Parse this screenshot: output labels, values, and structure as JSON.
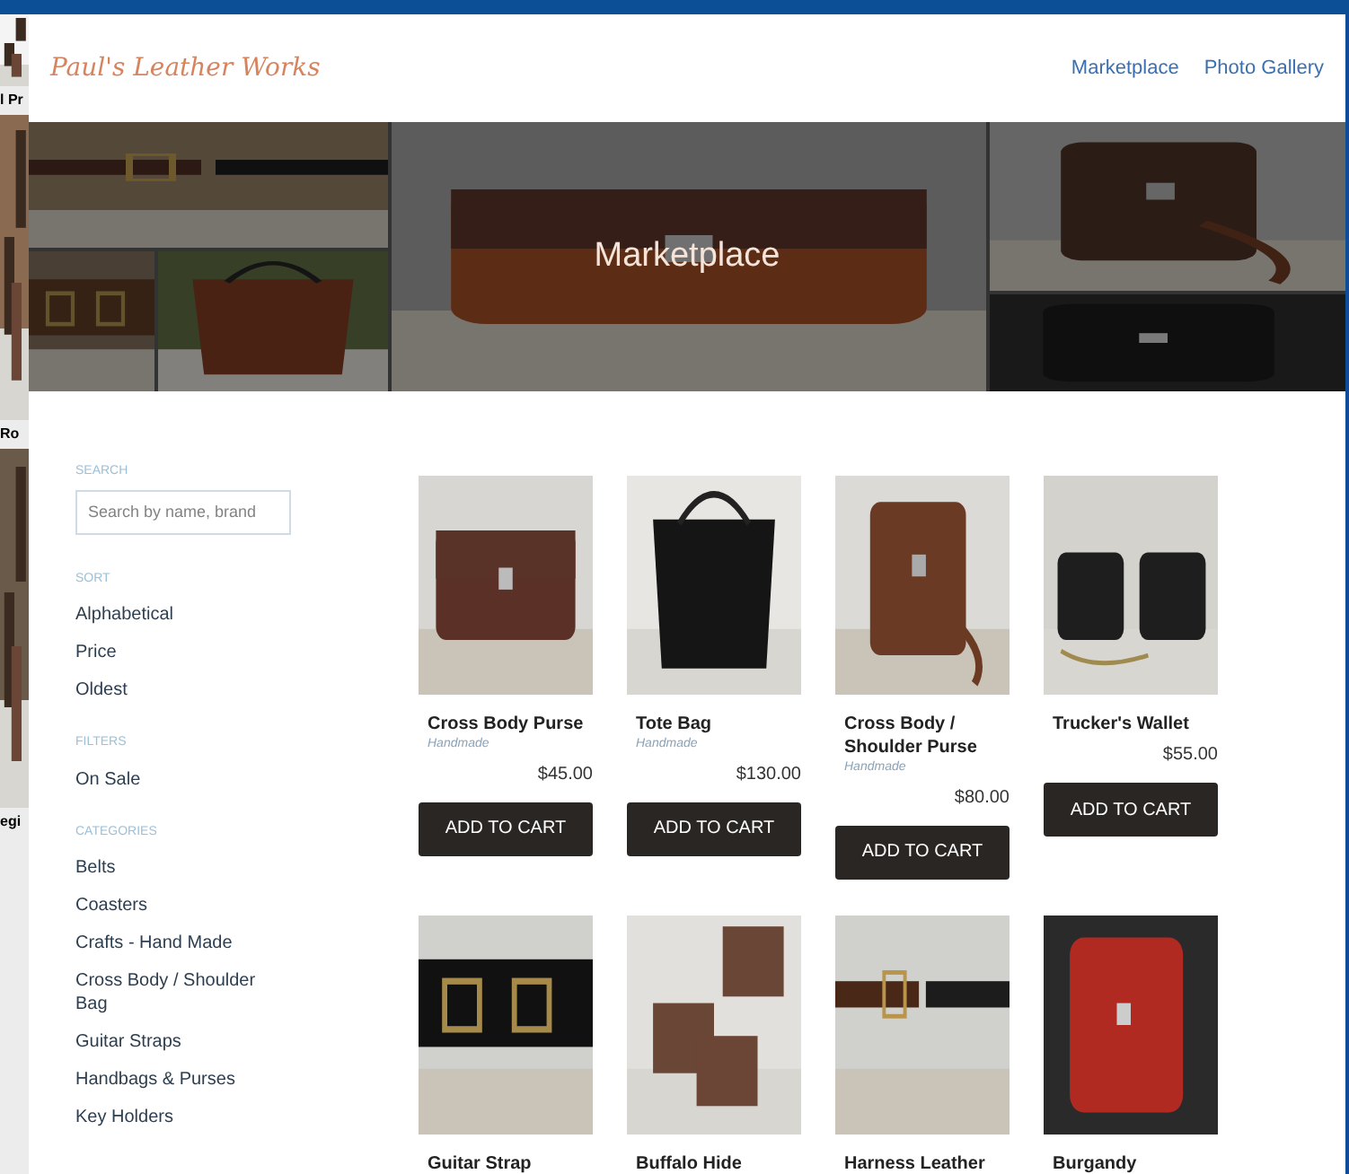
{
  "background_fragments": [
    "l Pr",
    "Ro",
    "egi"
  ],
  "header": {
    "logo": "Paul's Leather Works",
    "nav": [
      {
        "label": "Marketplace"
      },
      {
        "label": "Photo Gallery"
      }
    ]
  },
  "hero": {
    "title": "Marketplace"
  },
  "sidebar": {
    "search_label": "SEARCH",
    "search": {
      "placeholder": "Search by name, brand"
    },
    "sections": [
      {
        "heading": "SORT",
        "items": [
          "Alphabetical",
          "Price",
          "Oldest"
        ]
      },
      {
        "heading": "FILTERS",
        "items": [
          "On Sale"
        ]
      },
      {
        "heading": "CATEGORIES",
        "items": [
          "Belts",
          "Coasters",
          "Crafts - Hand Made",
          "Cross Body / Shoulder Bag",
          "Guitar Straps",
          "Handbags & Purses",
          "Key Holders"
        ]
      }
    ]
  },
  "products": [
    {
      "name": "Cross Body Purse",
      "subtitle": "Handmade",
      "price": "$45.00",
      "button": "ADD TO CART"
    },
    {
      "name": "Tote Bag",
      "subtitle": "Handmade",
      "price": "$130.00",
      "button": "ADD TO CART"
    },
    {
      "name": "Cross Body / Shoulder Purse",
      "subtitle": "Handmade",
      "price": "$80.00",
      "button": "ADD TO CART"
    },
    {
      "name": "Trucker's Wallet",
      "price": "$55.00",
      "button": "ADD TO CART"
    },
    {
      "name": "Guitar Strap"
    },
    {
      "name": "Buffalo Hide"
    },
    {
      "name": "Harness Leather"
    },
    {
      "name": "Burgandy"
    }
  ]
}
